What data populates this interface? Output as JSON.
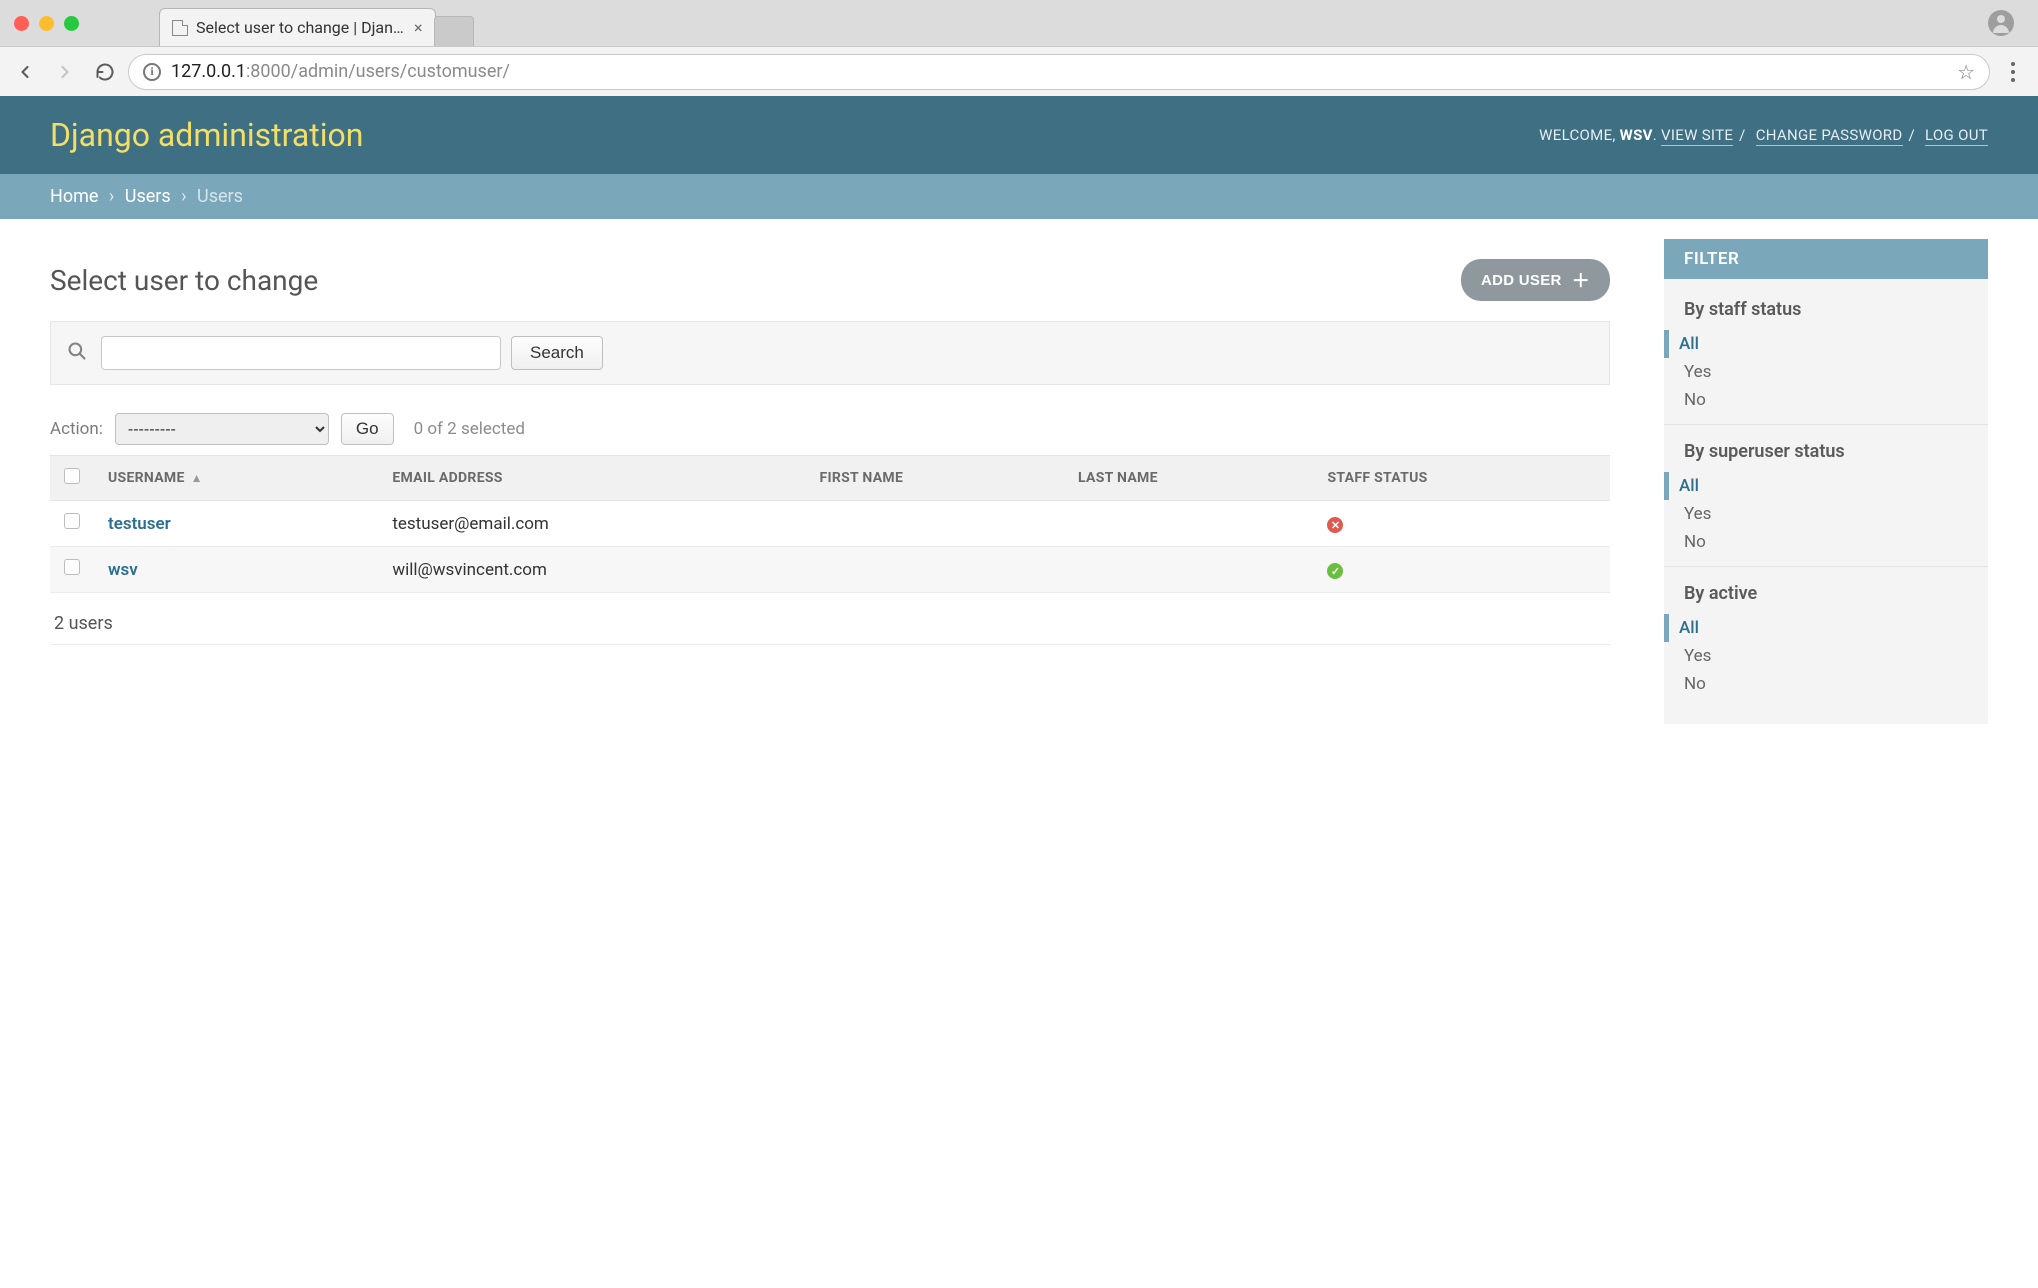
{
  "browser": {
    "tab_title": "Select user to change | Django",
    "url_host": "127.0.0.1",
    "url_port_path": ":8000/admin/users/customuser/"
  },
  "header": {
    "branding": "Django administration",
    "welcome": "WELCOME, ",
    "username": "WSV",
    "view_site": "VIEW SITE",
    "change_password": "CHANGE PASSWORD",
    "logout": "LOG OUT"
  },
  "breadcrumbs": {
    "home": "Home",
    "app": "Users",
    "model": "Users"
  },
  "page": {
    "title": "Select user to change",
    "add_label": "ADD USER"
  },
  "search": {
    "button": "Search",
    "value": ""
  },
  "actions": {
    "label": "Action:",
    "placeholder": "---------",
    "go": "Go",
    "selected_text": "0 of 2 selected"
  },
  "columns": {
    "username": "USERNAME",
    "email": "EMAIL ADDRESS",
    "first_name": "FIRST NAME",
    "last_name": "LAST NAME",
    "staff": "STAFF STATUS"
  },
  "rows": [
    {
      "username": "testuser",
      "email": "testuser@email.com",
      "first_name": "",
      "last_name": "",
      "is_staff": false
    },
    {
      "username": "wsv",
      "email": "will@wsvincent.com",
      "first_name": "",
      "last_name": "",
      "is_staff": true
    }
  ],
  "paginator": "2 users",
  "filter": {
    "title": "FILTER",
    "groups": [
      {
        "label": "By staff status",
        "options": [
          "All",
          "Yes",
          "No"
        ],
        "selected": "All"
      },
      {
        "label": "By superuser status",
        "options": [
          "All",
          "Yes",
          "No"
        ],
        "selected": "All"
      },
      {
        "label": "By active",
        "options": [
          "All",
          "Yes",
          "No"
        ],
        "selected": "All"
      }
    ]
  }
}
